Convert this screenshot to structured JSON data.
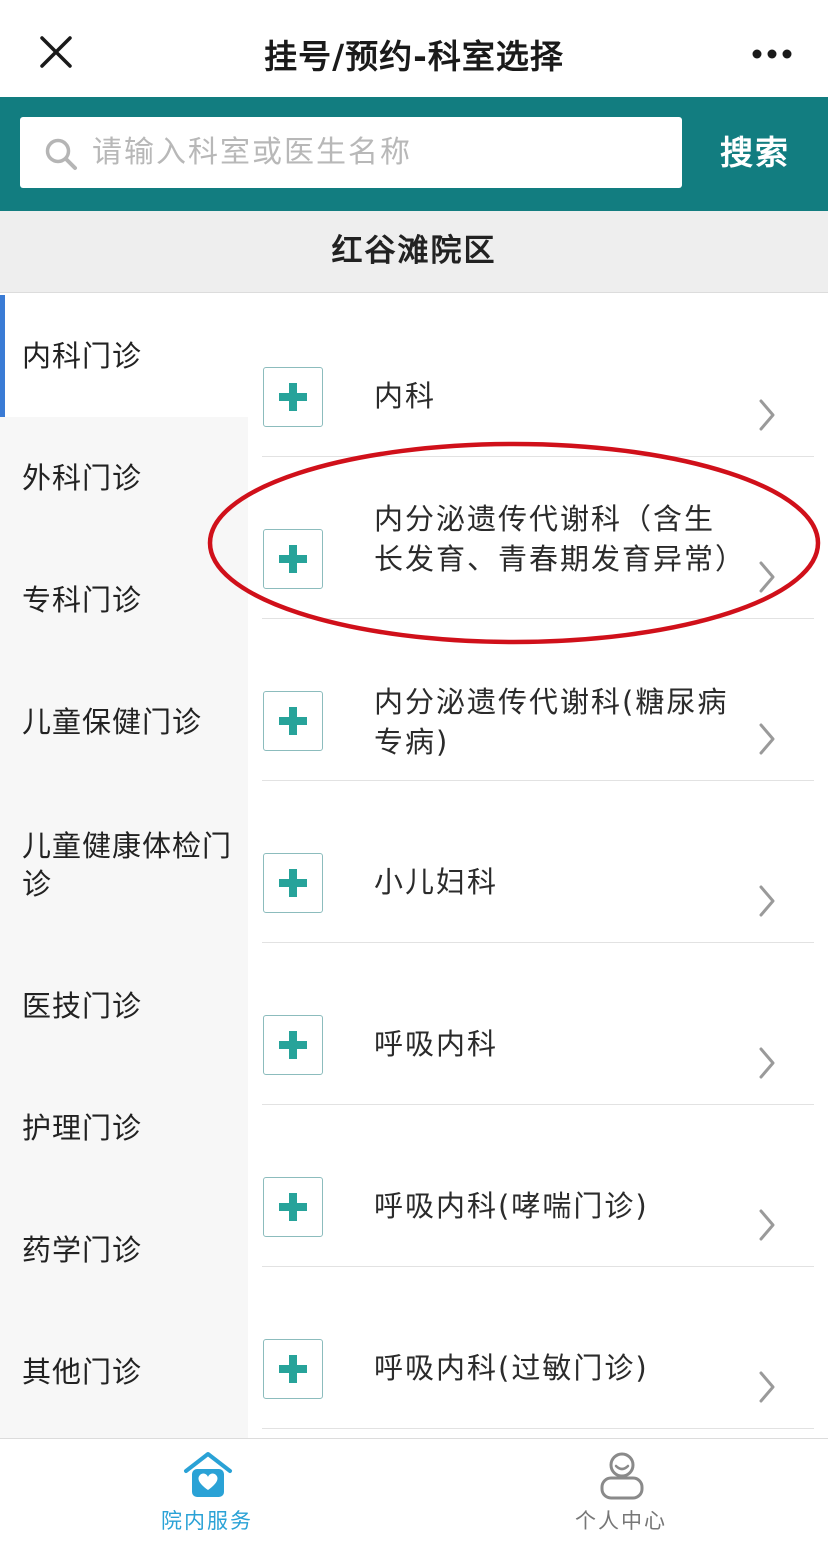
{
  "header": {
    "title": "挂号/预约-科室选择",
    "close_icon": "close-icon",
    "more_icon": "more-icon"
  },
  "search": {
    "placeholder": "请输入科室或医生名称",
    "value": "",
    "button_label": "搜索",
    "icon": "search-icon"
  },
  "campus": {
    "name": "红谷滩院区"
  },
  "sidebar": {
    "items": [
      {
        "label": "内科门诊",
        "active": true
      },
      {
        "label": "外科门诊",
        "active": false
      },
      {
        "label": "专科门诊",
        "active": false
      },
      {
        "label": "儿童保健门诊",
        "active": false
      },
      {
        "label": "儿童健康体检门诊",
        "active": false
      },
      {
        "label": "医技门诊",
        "active": false
      },
      {
        "label": "护理门诊",
        "active": false
      },
      {
        "label": "药学门诊",
        "active": false
      },
      {
        "label": "其他门诊",
        "active": false
      }
    ]
  },
  "departments": [
    {
      "name": "内科"
    },
    {
      "name": "内分泌遗传代谢科（含生长发育、青春期发育异常）"
    },
    {
      "name": "内分泌遗传代谢科(糖尿病专病)"
    },
    {
      "name": "小儿妇科"
    },
    {
      "name": "呼吸内科"
    },
    {
      "name": "呼吸内科(哮喘门诊)"
    },
    {
      "name": "呼吸内科(过敏门诊)"
    }
  ],
  "tabbar": {
    "tabs": [
      {
        "label": "院内服务",
        "icon": "hospital-heart-icon",
        "active": true
      },
      {
        "label": "个人中心",
        "icon": "user-icon",
        "active": false
      }
    ]
  },
  "colors": {
    "brand_teal": "#127d80",
    "plus_green": "#27a39a",
    "active_indicator": "#3a7bd5",
    "active_tab": "#2aa2d6",
    "annotation_red": "#d0101a"
  }
}
